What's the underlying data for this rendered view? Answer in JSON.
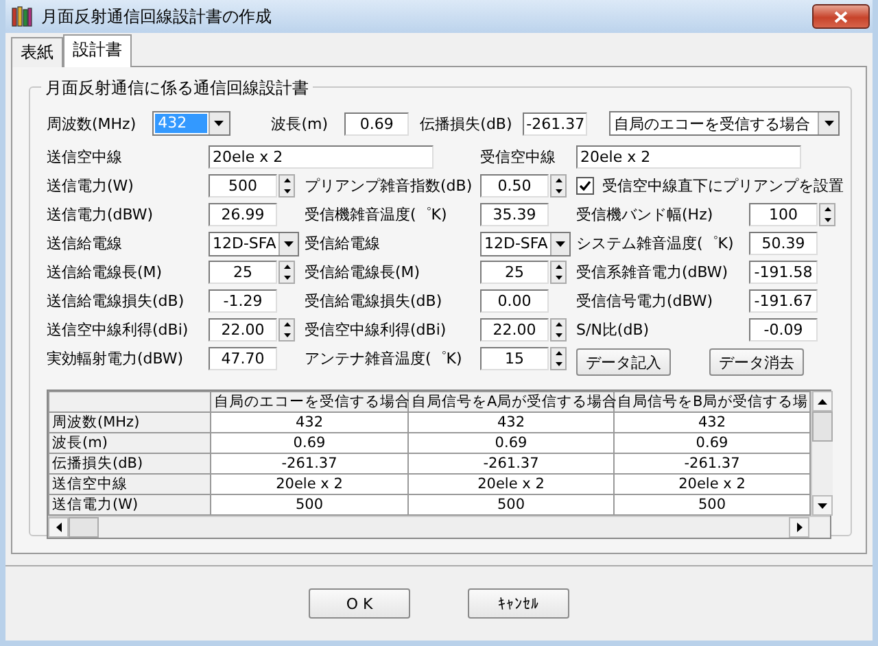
{
  "window": {
    "title": "月面反射通信回線設計書の作成"
  },
  "tabs": [
    {
      "label": "表紙",
      "selected": false
    },
    {
      "label": "設計書",
      "selected": true
    }
  ],
  "group": {
    "title": "月面反射通信に係る通信回線設計書"
  },
  "top_row": {
    "frequency": {
      "label": "周波数(MHz)",
      "value": "432",
      "highlighted": true
    },
    "wavelength": {
      "label": "波長(m)",
      "value": "0.69"
    },
    "loss": {
      "label": "伝播損失(dB)",
      "value": "-261.37"
    },
    "mode": {
      "value": "自局のエコーを受信する場合"
    }
  },
  "rows": [
    [
      {
        "kind": "label",
        "text": "送信空中線"
      },
      {
        "kind": "wide",
        "value": "20ele x 2"
      },
      {
        "kind": "label",
        "text": "受信空中線"
      },
      {
        "kind": "wide",
        "value": "20ele x 2"
      }
    ],
    [
      {
        "kind": "label",
        "text": "送信電力(W)"
      },
      {
        "kind": "spin",
        "value": "500"
      },
      {
        "kind": "label",
        "text": "プリアンプ雑音指数(dB)"
      },
      {
        "kind": "spin",
        "value": "0.50"
      },
      {
        "kind": "check",
        "label": "受信空中線直下にプリアンプを設置",
        "checked": true
      }
    ],
    [
      {
        "kind": "label",
        "text": "送信電力(dBW)"
      },
      {
        "kind": "text",
        "value": "26.99"
      },
      {
        "kind": "label",
        "text": "受信機雑音温度(゜K)"
      },
      {
        "kind": "text",
        "value": "35.39"
      },
      {
        "kind": "label",
        "text": "受信機バンド幅(Hz)"
      },
      {
        "kind": "spin",
        "value": "100"
      }
    ],
    [
      {
        "kind": "label",
        "text": "送信給電線"
      },
      {
        "kind": "combo",
        "value": "12D-SFA"
      },
      {
        "kind": "label",
        "text": "受信給電線"
      },
      {
        "kind": "combo",
        "value": "12D-SFA"
      },
      {
        "kind": "label",
        "text": "システム雑音温度(゜K)"
      },
      {
        "kind": "text",
        "value": "50.39"
      }
    ],
    [
      {
        "kind": "label",
        "text": "送信給電線長(M)"
      },
      {
        "kind": "spin",
        "value": "25"
      },
      {
        "kind": "label",
        "text": "受信給電線長(M)"
      },
      {
        "kind": "spin",
        "value": "25"
      },
      {
        "kind": "label",
        "text": "受信系雑音電力(dBW)"
      },
      {
        "kind": "text",
        "value": "-191.58"
      }
    ],
    [
      {
        "kind": "label",
        "text": "送信給電線損失(dB)"
      },
      {
        "kind": "text",
        "value": "-1.29"
      },
      {
        "kind": "label",
        "text": "受信給電線損失(dB)"
      },
      {
        "kind": "text",
        "value": "0.00"
      },
      {
        "kind": "label",
        "text": "受信信号電力(dBW)"
      },
      {
        "kind": "text",
        "value": "-191.67"
      }
    ],
    [
      {
        "kind": "label",
        "text": "送信空中線利得(dBi)"
      },
      {
        "kind": "spin",
        "value": "22.00"
      },
      {
        "kind": "label",
        "text": "受信空中線利得(dBi)"
      },
      {
        "kind": "spin",
        "value": "22.00"
      },
      {
        "kind": "label",
        "text": "S/N比(dB)"
      },
      {
        "kind": "text",
        "value": "-0.09"
      }
    ],
    [
      {
        "kind": "label",
        "text": "実効輻射電力(dBW)"
      },
      {
        "kind": "text",
        "value": "47.70"
      },
      {
        "kind": "label",
        "text": "アンテナ雑音温度(゜K)"
      },
      {
        "kind": "spin",
        "value": "15"
      },
      {
        "kind": "buttons",
        "buttons": [
          "データ記入",
          "データ消去"
        ]
      }
    ]
  ],
  "table": {
    "columns": [
      "自局のエコーを受信する場合",
      "自局信号をA局が受信する場合",
      "自局信号をB局が受信する場"
    ],
    "rows": [
      {
        "label": "周波数(MHz)",
        "values": [
          "432",
          "432",
          "432"
        ]
      },
      {
        "label": "波長(m)",
        "values": [
          "0.69",
          "0.69",
          "0.69"
        ]
      },
      {
        "label": "伝播損失(dB)",
        "values": [
          "-261.37",
          "-261.37",
          "-261.37"
        ]
      },
      {
        "label": "送信空中線",
        "values": [
          "20ele x 2",
          "20ele x 2",
          "20ele x 2"
        ]
      },
      {
        "label": "送信電力(W)",
        "values": [
          "500",
          "500",
          "500"
        ]
      }
    ]
  },
  "buttons": [
    "O K",
    "ｷｬﾝｾﾙ"
  ]
}
